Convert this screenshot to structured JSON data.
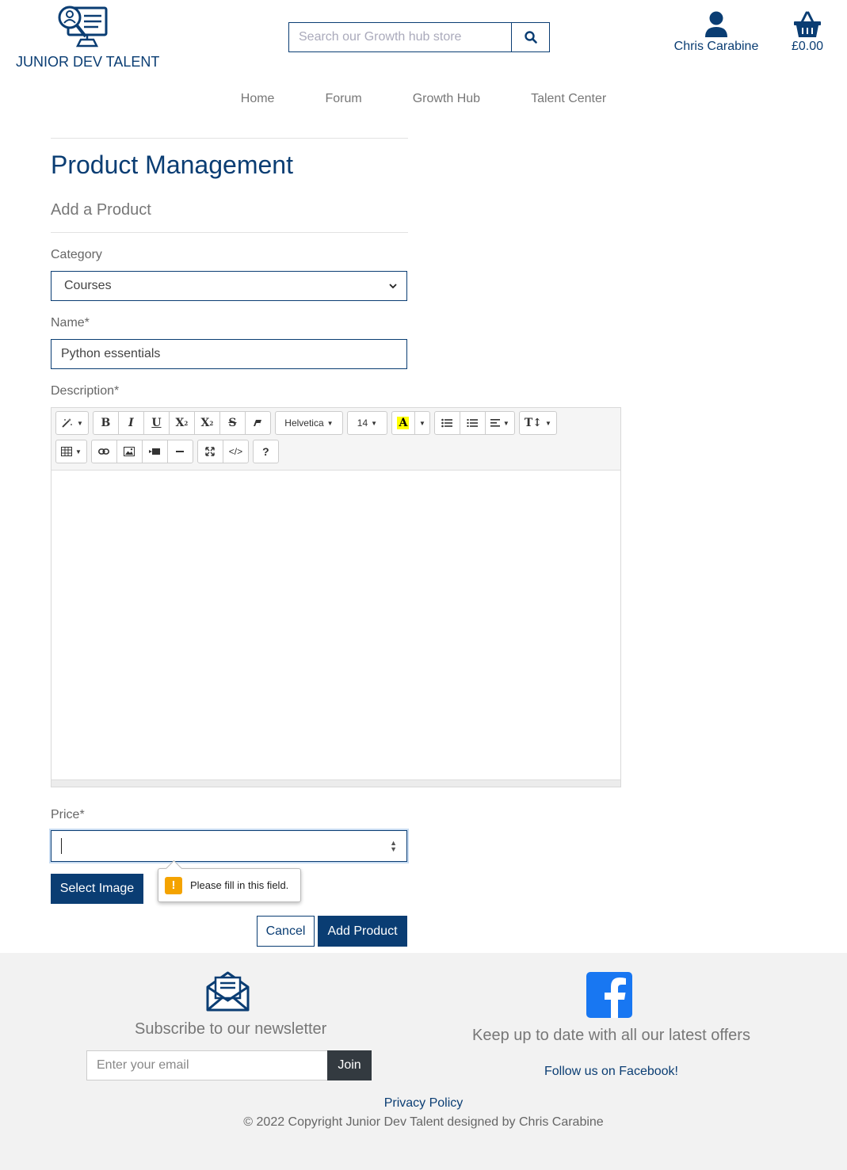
{
  "header": {
    "logo_text": "JUNIOR DEV TALENT",
    "search_placeholder": "Search our Growth hub store",
    "account_name": "Chris Carabine",
    "basket_total": "£0.00"
  },
  "nav": {
    "items": [
      "Home",
      "Forum",
      "Growth Hub",
      "Talent Center"
    ]
  },
  "form": {
    "title": "Product Management",
    "subtitle": "Add a Product",
    "category_label": "Category",
    "category_value": "Courses",
    "name_label": "Name*",
    "name_value": "Python essentials",
    "description_label": "Description*",
    "price_label": "Price*",
    "price_value": "",
    "select_image_label": "Select Image",
    "cancel_label": "Cancel",
    "submit_label": "Add Product",
    "validation_message": "Please fill in this field."
  },
  "editor": {
    "font_name": "Helvetica",
    "font_size": "14"
  },
  "footer": {
    "newsletter_title": "Subscribe to our newsletter",
    "email_placeholder": "Enter your email",
    "join_label": "Join",
    "offers_text": "Keep up to date with all our latest offers",
    "facebook_link": "Follow us on Facebook!",
    "privacy_link": "Privacy Policy",
    "copyright": "© 2022 Copyright Junior Dev Talent designed by Chris Carabine"
  },
  "colors": {
    "brand": "#0a3d73",
    "facebook": "#1877f2",
    "warning": "#f4a300",
    "footer_bg": "#f2f2f2"
  }
}
